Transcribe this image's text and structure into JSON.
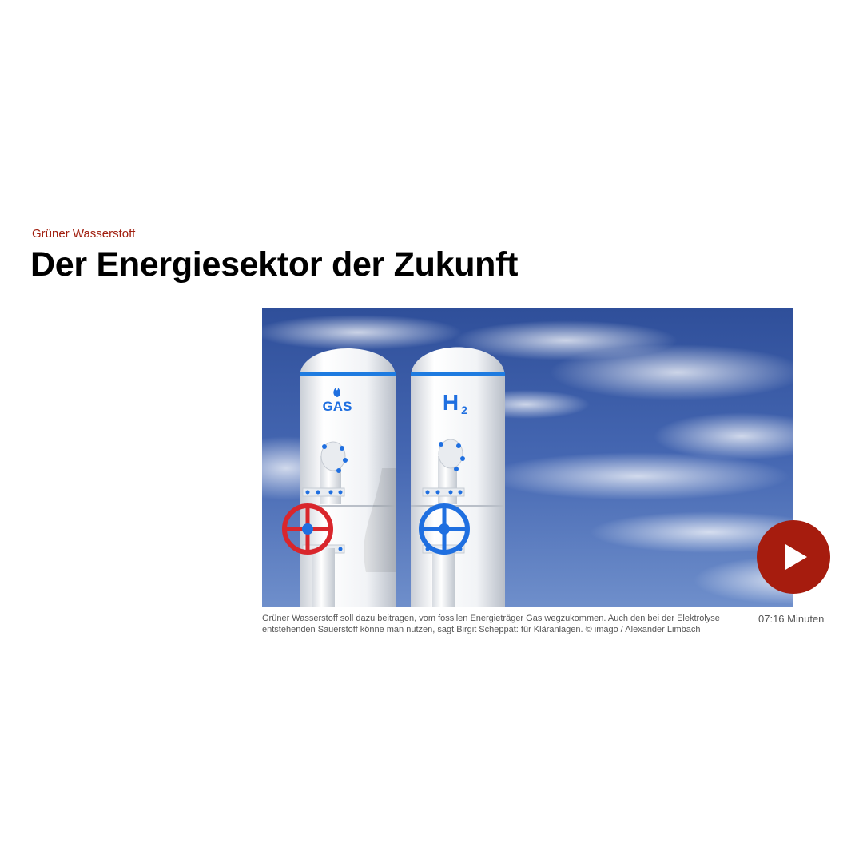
{
  "article": {
    "kicker": "Grüner Wasserstoff",
    "headline": "Der Energiesektor der Zukunft"
  },
  "media": {
    "tank_labels": {
      "left": "GAS",
      "right_main": "H",
      "right_sub": "2"
    },
    "caption": "Grüner Wasserstoff soll dazu beitragen, vom fossilen Energieträger Gas wegzukommen. Auch den bei der Elektrolyse entstehenden Sauerstoff könne man nutzen, sagt Birgit Scheppat: für Kläranlagen. © imago / Alexander Limbach",
    "duration": "07:16 Minuten",
    "play_icon": "play-icon"
  },
  "colors": {
    "accent": "#a61c0e",
    "kicker": "#a01d0d",
    "sky": "#3d5fa8",
    "tank_band": "#1e7be0",
    "valve_red": "#d9262c",
    "valve_blue": "#1f6fe0"
  }
}
